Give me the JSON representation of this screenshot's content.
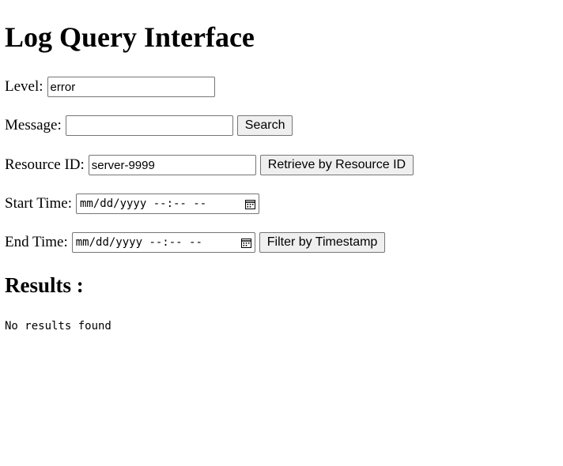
{
  "page": {
    "title": "Log Query Interface"
  },
  "form": {
    "level": {
      "label": "Level:",
      "value": "error"
    },
    "message": {
      "label": "Message:",
      "value": "",
      "button": "Search"
    },
    "resource": {
      "label": "Resource ID:",
      "value": "server-9999",
      "button": "Retrieve by Resource ID"
    },
    "start_time": {
      "label": "Start Time:",
      "placeholder": "mm/dd/yyyy --:-- --"
    },
    "end_time": {
      "label": "End Time:",
      "placeholder": "mm/dd/yyyy --:-- --",
      "button": "Filter by Timestamp"
    }
  },
  "results": {
    "heading": "Results :",
    "message": "No results found"
  },
  "icons": {
    "calendar": "calendar-icon"
  }
}
